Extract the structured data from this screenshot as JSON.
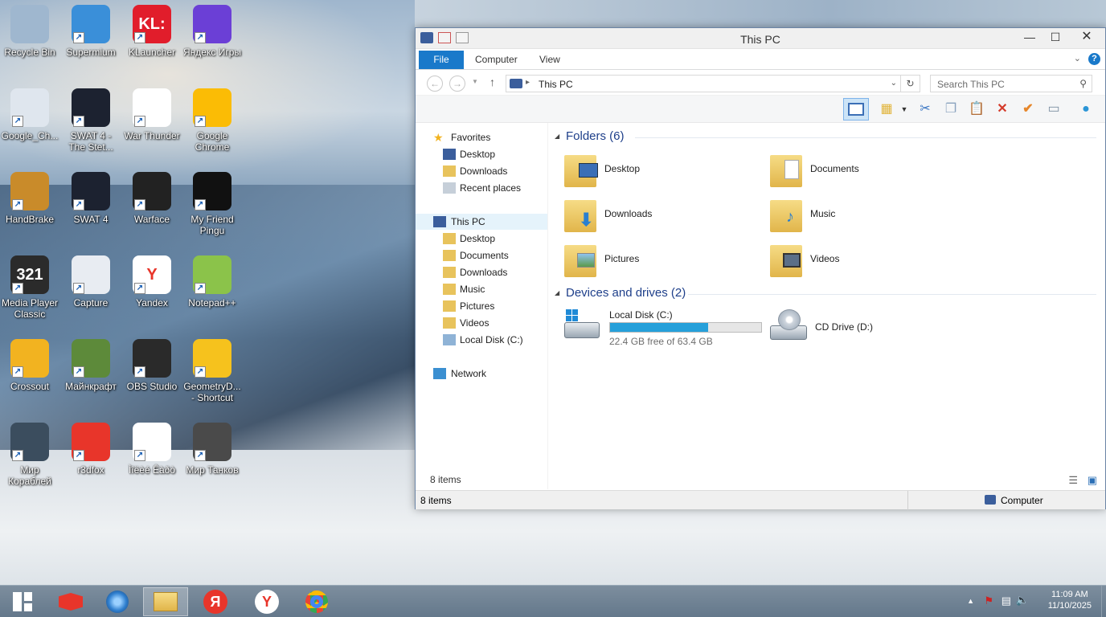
{
  "desktop": {
    "icons": [
      {
        "label": "Recycle Bin",
        "color": "#9fb7cf",
        "glyph": ""
      },
      {
        "label": "Supermium",
        "color": "#3a8fd9",
        "glyph": ""
      },
      {
        "label": "KLauncher",
        "color": "#e11d2b",
        "glyph": "KL:"
      },
      {
        "label": "Яндекс Игры",
        "color": "#6b3fd6",
        "glyph": ""
      },
      {
        "label": "Google_Ch...",
        "color": "#dfe6ee",
        "glyph": ""
      },
      {
        "label": "SWAT 4 - The Stet...",
        "color": "#1c2230",
        "glyph": ""
      },
      {
        "label": "War Thunder",
        "color": "#ffffff",
        "glyph": ""
      },
      {
        "label": "Google Chrome",
        "color": "#fbbc05",
        "glyph": ""
      },
      {
        "label": "HandBrake",
        "color": "#c98b2a",
        "glyph": ""
      },
      {
        "label": "SWAT 4",
        "color": "#1c2230",
        "glyph": ""
      },
      {
        "label": "Warface",
        "color": "#222222",
        "glyph": ""
      },
      {
        "label": "My Friend Pingu",
        "color": "#111111",
        "glyph": ""
      },
      {
        "label": "Media Player Classic",
        "color": "#2b2b2b",
        "glyph": "321"
      },
      {
        "label": "Capture",
        "color": "#e8ecf2",
        "glyph": ""
      },
      {
        "label": "Yandex",
        "color": "#ffffff",
        "glyph": "Y"
      },
      {
        "label": "Notepad++",
        "color": "#8bc34a",
        "glyph": ""
      },
      {
        "label": "Crossout",
        "color": "#f2b320",
        "glyph": ""
      },
      {
        "label": "Майнкрафт",
        "color": "#5d8a3a",
        "glyph": ""
      },
      {
        "label": "OBS Studio",
        "color": "#2a2a2a",
        "glyph": ""
      },
      {
        "label": "GeometryD... - Shortcut",
        "color": "#f6c21d",
        "glyph": ""
      },
      {
        "label": "Мир Кораблей",
        "color": "#3b4d5e",
        "glyph": ""
      },
      {
        "label": "r3dfox",
        "color": "#e8352a",
        "glyph": ""
      },
      {
        "label": "Ìîëèé Êàðò",
        "color": "#ffffff",
        "glyph": ""
      },
      {
        "label": "Мир Танков",
        "color": "#4a4a4a",
        "glyph": ""
      }
    ]
  },
  "window": {
    "title": "This PC",
    "controls": {
      "minimize": "—",
      "maximize": "☐",
      "close": "✕"
    },
    "ribbon_tabs": [
      "File",
      "Computer",
      "View"
    ],
    "address": "This PC",
    "search_placeholder": "Search This PC",
    "nav": {
      "favorites": "Favorites",
      "fav_items": [
        "Desktop",
        "Downloads",
        "Recent places"
      ],
      "this_pc": "This PC",
      "pc_items": [
        "Desktop",
        "Documents",
        "Downloads",
        "Music",
        "Pictures",
        "Videos",
        "Local Disk (C:)"
      ],
      "network": "Network"
    },
    "folders_header": "Folders (6)",
    "folders": [
      "Desktop",
      "Documents",
      "Downloads",
      "Music",
      "Pictures",
      "Videos"
    ],
    "devices_header": "Devices and drives (2)",
    "drives": {
      "c_name": "Local Disk (C:)",
      "c_free": "22.4 GB free of 63.4 GB",
      "c_used_fraction": 0.647,
      "d_name": "CD Drive (D:)"
    },
    "status_items": "8 items",
    "details_items": "8 items",
    "details_location": "Computer"
  },
  "taskbar": {
    "time": "11:09 AM",
    "date": "11/10/2025"
  },
  "colors": {
    "accent": "#1979ca",
    "header_blue": "#1e3f8a",
    "drive_bar": "#26a0da"
  }
}
